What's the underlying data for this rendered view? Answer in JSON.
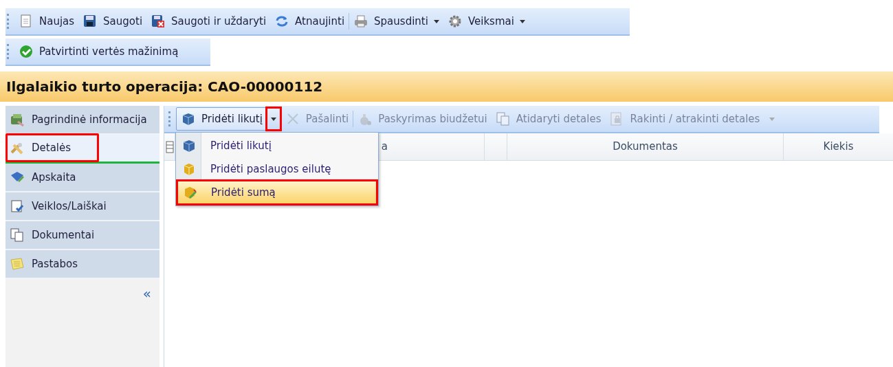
{
  "toolbar": [
    {
      "label": "Naujas"
    },
    {
      "label": "Saugoti"
    },
    {
      "label": "Saugoti ir uždaryti"
    },
    {
      "label": "Atnaujinti",
      "sep_after": true
    },
    {
      "label": "Spausdinti",
      "dropdown": true
    },
    {
      "label": "Veiksmai",
      "dropdown": true
    }
  ],
  "toolbar2": [
    {
      "label": "Patvirtinti vertės mažinimą"
    }
  ],
  "title": "Ilgalaikio turto operacija: CAO-00000112",
  "sidebar": {
    "items": [
      {
        "label": "Pagrindinė informacija",
        "selected": false,
        "highlighted": false
      },
      {
        "label": "Detalės",
        "selected": true,
        "highlighted": true
      },
      {
        "label": "Apskaita",
        "selected": false,
        "highlighted": false
      },
      {
        "label": "Veiklos/Laiškai",
        "selected": false,
        "highlighted": false
      },
      {
        "label": "Dokumentai",
        "selected": false,
        "highlighted": false
      },
      {
        "label": "Pastabos",
        "selected": false,
        "highlighted": false
      }
    ],
    "collapse": "«"
  },
  "detail_toolbar": [
    {
      "label": "Pridėti likutį",
      "kind": "split",
      "disabled": false,
      "arrow_highlighted": true
    },
    {
      "label": "Pašalinti",
      "kind": "button",
      "disabled": true
    },
    {
      "label": "Paskyrimas biudžetui",
      "kind": "button",
      "disabled": true
    },
    {
      "label": "Atidaryti detales",
      "kind": "button",
      "disabled": true
    },
    {
      "label": "Rakinti / atrakinti detales",
      "kind": "button",
      "disabled": true
    }
  ],
  "menu": [
    {
      "label": "Pridėti likutį",
      "selected": false,
      "highlighted": false
    },
    {
      "label": "Pridėti paslaugos eilutę",
      "selected": false,
      "highlighted": false
    },
    {
      "label": "Pridėti sumą",
      "selected": true,
      "highlighted": true
    }
  ],
  "table": {
    "columns": [
      "a",
      "",
      "Dokumentas",
      "Kiekis"
    ]
  }
}
